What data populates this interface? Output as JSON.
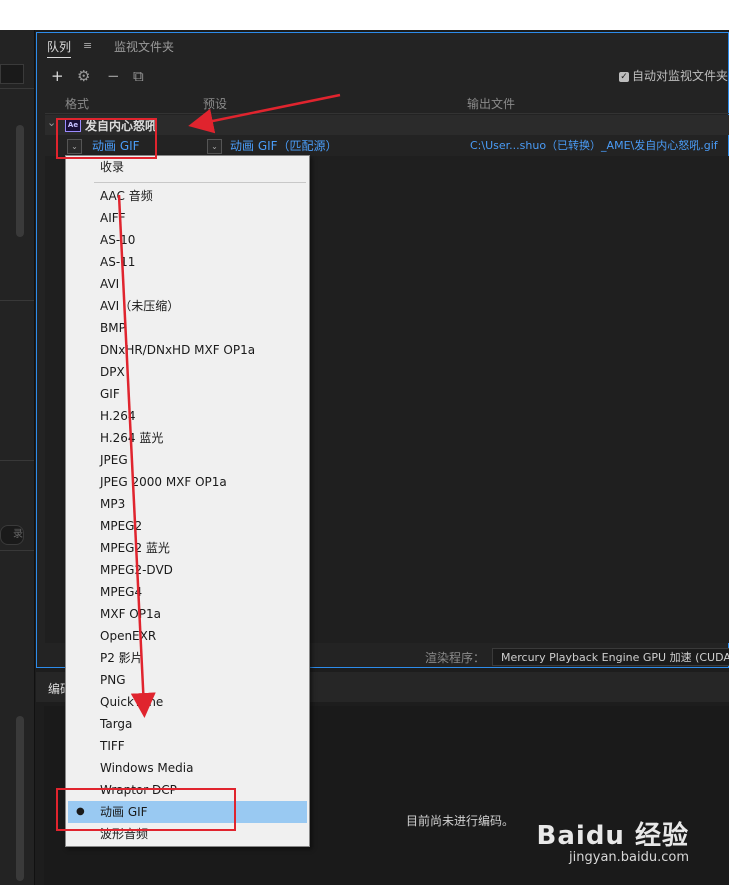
{
  "queue": {
    "tabs": [
      {
        "label": "队列"
      },
      {
        "label": "监视文件夹"
      }
    ],
    "tab_menu_icon": "≡",
    "toolbar": {
      "add": "+",
      "settings": "⚙",
      "remove": "−",
      "duplicate": "⧉"
    },
    "auto_watch_label": "自动对监视文件夹",
    "columns": {
      "format": "格式",
      "preset": "预设",
      "output": "输出文件"
    },
    "group": {
      "expand_icon": "⌄",
      "app_badge": "Ae",
      "name": "发自内心怒吼"
    },
    "job": {
      "format": "动画 GIF",
      "preset": "动画 GIF（匹配源）",
      "output": "C:\\User...shuo（已转换）_AME\\发自内心怒吼.gif"
    },
    "renderer": {
      "label": "渲染程序：",
      "value": "Mercury Playback Engine GPU 加速 (CUDA)"
    }
  },
  "encode": {
    "header_label": "编码",
    "status": "目前尚未进行编码。"
  },
  "format_menu": {
    "header": "收录",
    "items": [
      "AAC 音频",
      "AIFF",
      "AS-10",
      "AS-11",
      "AVI",
      "AVI（未压缩）",
      "BMP",
      "DNxHR/DNxHD MXF OP1a",
      "DPX",
      "GIF",
      "H.264",
      "H.264 蓝光",
      "JPEG",
      "JPEG 2000 MXF OP1a",
      "MP3",
      "MPEG2",
      "MPEG2 蓝光",
      "MPEG2-DVD",
      "MPEG4",
      "MXF OP1a",
      "OpenEXR",
      "P2 影片",
      "PNG",
      "QuickTime",
      "Targa",
      "TIFF",
      "Windows Media",
      "Wraptor DCP",
      "动画 GIF",
      "波形音频"
    ],
    "selected_index": 28
  },
  "watermark": {
    "brand": "Baidu 经验",
    "url": "jingyan.baidu.com"
  },
  "colors": {
    "accent": "#2d8ceb",
    "link": "#4a9cf7",
    "highlight": "#99c9f2",
    "annotation_red": "#e0242e"
  }
}
